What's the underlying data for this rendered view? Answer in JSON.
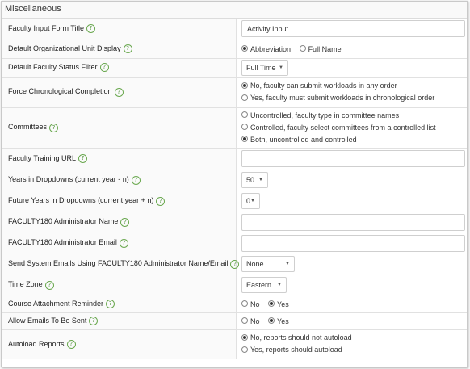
{
  "section": {
    "title": "Miscellaneous"
  },
  "rows": {
    "form_title": {
      "label": "Faculty Input Form Title",
      "value": "Activity Input"
    },
    "org_unit": {
      "label": "Default Organizational Unit Display",
      "options": [
        "Abbreviation",
        "Full Name"
      ],
      "selected": "Abbreviation"
    },
    "status_filter": {
      "label": "Default Faculty Status Filter",
      "value": "Full Time"
    },
    "chrono": {
      "label": "Force Chronological Completion",
      "options": [
        "No, faculty can submit workloads in any order",
        "Yes, faculty must submit workloads in chronological order"
      ],
      "selected": "No, faculty can submit workloads in any order"
    },
    "committees": {
      "label": "Committees",
      "options": [
        "Uncontrolled, faculty type in committee names",
        "Controlled, faculty select committees from a controlled list",
        "Both, uncontrolled and controlled"
      ],
      "selected": "Both, uncontrolled and controlled"
    },
    "training_url": {
      "label": "Faculty Training URL",
      "value": ""
    },
    "years_back": {
      "label": "Years in Dropdowns (current year - n)",
      "value": "50"
    },
    "years_future": {
      "label": "Future Years in Dropdowns (current year + n)",
      "value": "0"
    },
    "admin_name": {
      "label": "FACULTY180 Administrator Name",
      "value": ""
    },
    "admin_email": {
      "label": "FACULTY180 Administrator Email",
      "value": ""
    },
    "send_as": {
      "label": "Send System Emails Using FACULTY180 Administrator Name/Email",
      "value": "None"
    },
    "timezone": {
      "label": "Time Zone",
      "value": "Eastern"
    },
    "attach_reminder": {
      "label": "Course Attachment Reminder",
      "options": [
        "No",
        "Yes"
      ],
      "selected": "Yes"
    },
    "allow_emails": {
      "label": "Allow Emails To Be Sent",
      "options": [
        "No",
        "Yes"
      ],
      "selected": "Yes"
    },
    "autoload": {
      "label": "Autoload Reports",
      "options": [
        "No, reports should not autoload",
        "Yes, reports should autoload"
      ],
      "selected": "No, reports should not autoload"
    }
  },
  "icons": {
    "help": "question-circle-icon",
    "caret": "caret-down-icon"
  },
  "colors": {
    "help_icon": "#4a8f34",
    "border": "#e1e1e1",
    "label_bg": "#fafafa"
  }
}
